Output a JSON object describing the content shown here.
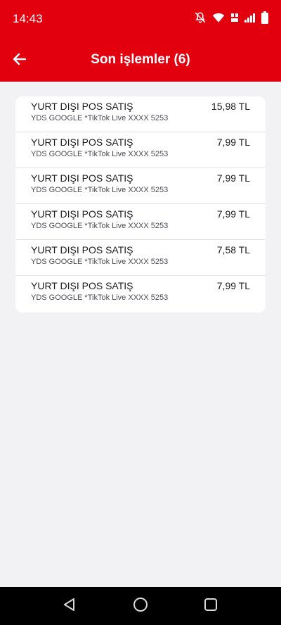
{
  "status_bar": {
    "time": "14:43",
    "icons": [
      "mute-icon",
      "wifi-icon",
      "volte-icon",
      "signal-icon",
      "battery-icon"
    ]
  },
  "header": {
    "title": "Son işlemler (6)",
    "back_icon": "arrow-left-icon"
  },
  "transactions": [
    {
      "title": "YURT DIŞI POS SATIŞ",
      "description": "YDS GOOGLE *TikTok Live XXXX 5253",
      "amount": "15,98 TL"
    },
    {
      "title": "YURT DIŞI POS SATIŞ",
      "description": "YDS GOOGLE *TikTok Live XXXX 5253",
      "amount": "7,99 TL"
    },
    {
      "title": "YURT DIŞI POS SATIŞ",
      "description": "YDS GOOGLE *TikTok Live XXXX 5253",
      "amount": "7,99 TL"
    },
    {
      "title": "YURT DIŞI POS SATIŞ",
      "description": "YDS GOOGLE *TikTok Live XXXX 5253",
      "amount": "7,99 TL"
    },
    {
      "title": "YURT DIŞI POS SATIŞ",
      "description": "YDS GOOGLE *TikTok Live XXXX 5253",
      "amount": "7,58 TL"
    },
    {
      "title": "YURT DIŞI POS SATIŞ",
      "description": "YDS GOOGLE *TikTok Live XXXX 5253",
      "amount": "7,99 TL"
    }
  ],
  "nav_bar": {
    "buttons": [
      "back-triangle-icon",
      "home-circle-icon",
      "recents-square-icon"
    ]
  },
  "colors": {
    "brand_red": "#e2000f",
    "background": "#f2f2f4",
    "card": "#ffffff"
  }
}
